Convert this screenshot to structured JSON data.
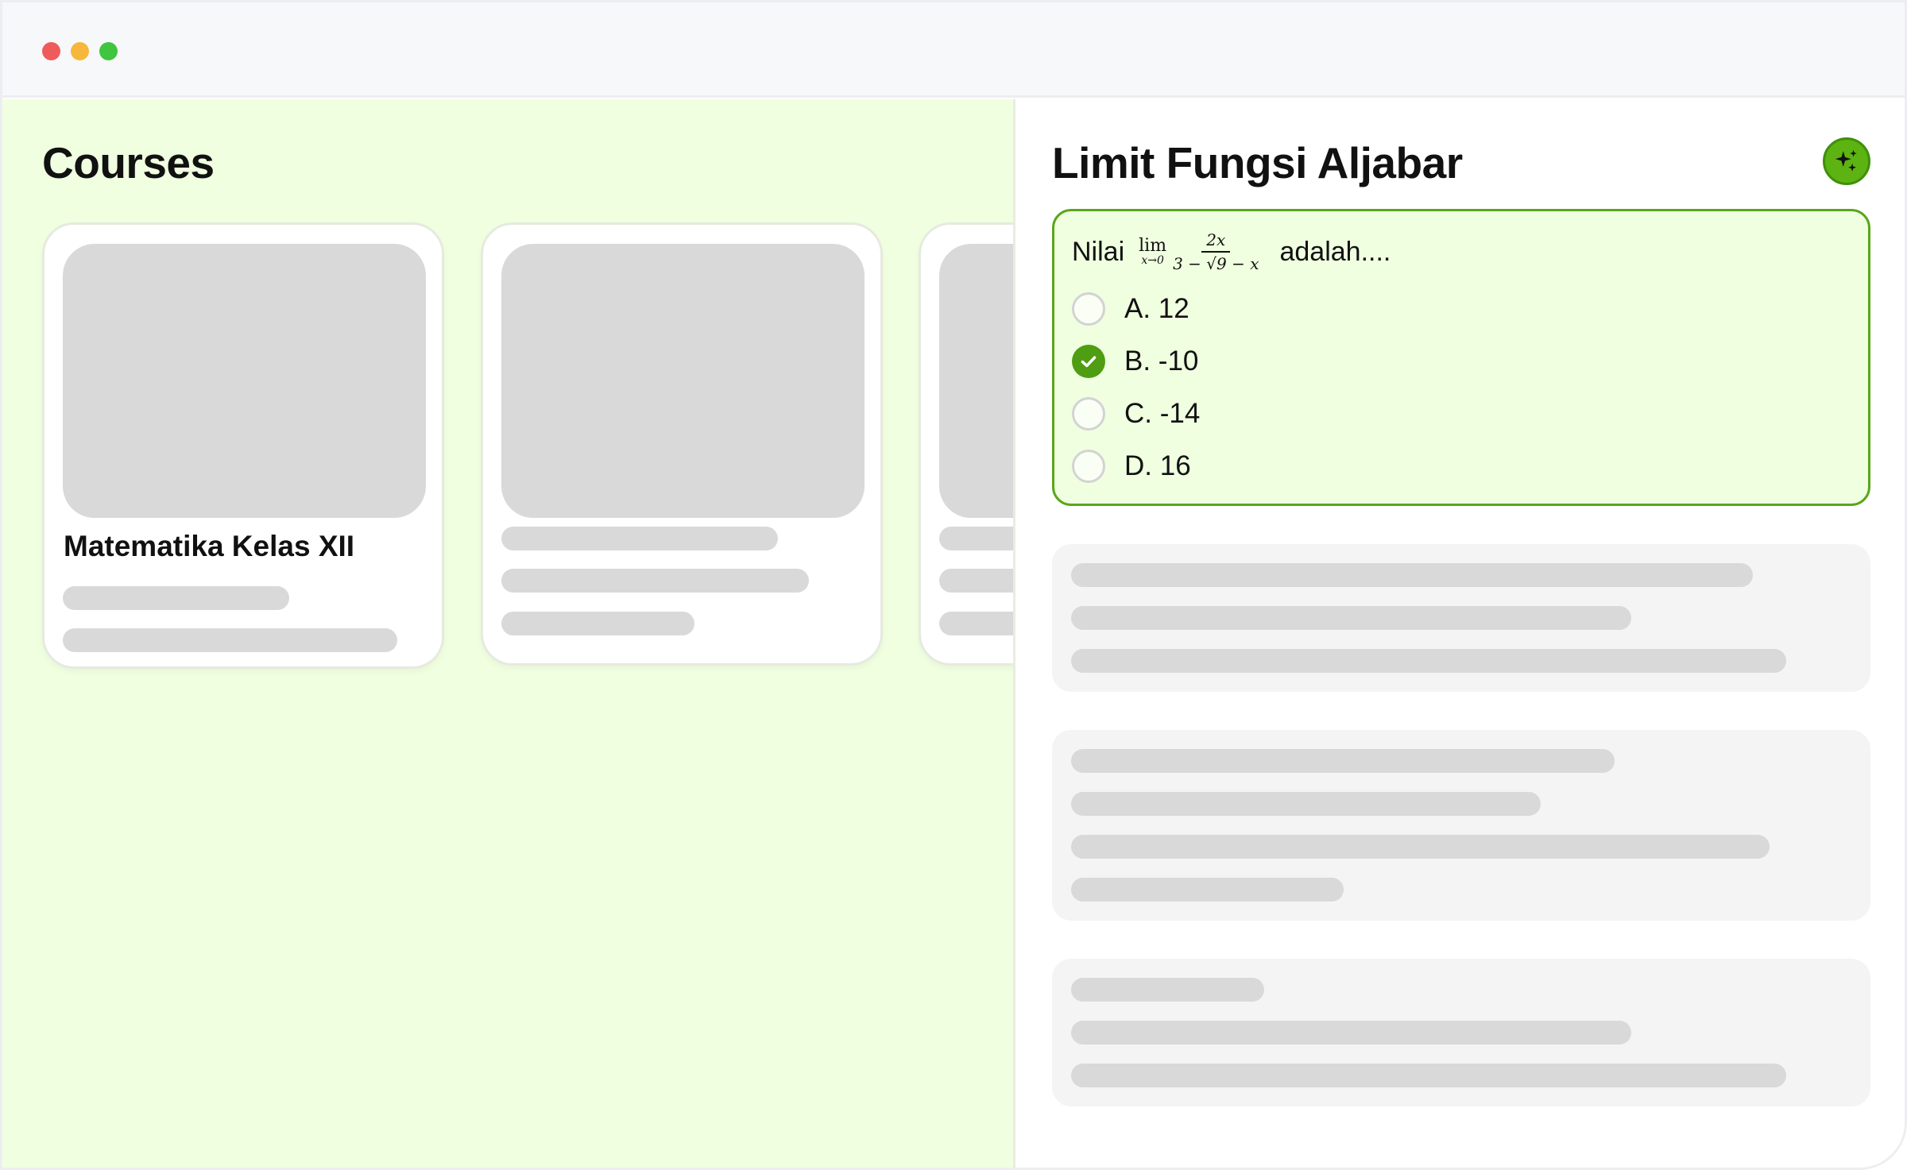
{
  "window": {
    "buttons": [
      "close",
      "minimize",
      "maximize"
    ]
  },
  "courses": {
    "title": "Courses",
    "cards": [
      {
        "name": "Matematika Kelas XII"
      },
      {
        "name": ""
      },
      {
        "name": ""
      }
    ]
  },
  "lesson": {
    "title": "Limit Fungsi Aljabar",
    "ai_icon": "sparkles-icon",
    "question": {
      "prefix": "Nilai",
      "math_lim": "lim",
      "math_sub": "x→0",
      "math_num": "2x",
      "math_den": "3 − √9 − x",
      "suffix": "adalah...."
    },
    "options": [
      {
        "label": "A. 12",
        "selected": false
      },
      {
        "label": "B. -10",
        "selected": true
      },
      {
        "label": "C. -14",
        "selected": false
      },
      {
        "label": "D. 16",
        "selected": false
      }
    ]
  },
  "colors": {
    "accent": "#5aa61c",
    "left_bg": "#f0ffe0",
    "skeleton": "#d9d9d9"
  }
}
